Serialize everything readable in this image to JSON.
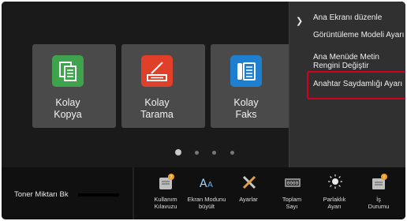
{
  "home": {
    "tiles": [
      {
        "line1": "Kolay",
        "line2": "Kopya",
        "icon": "copy-icon",
        "color": "#3fa34d"
      },
      {
        "line1": "Kolay",
        "line2": "Tarama",
        "icon": "scan-icon",
        "color": "#e0402a"
      },
      {
        "line1": "Kolay",
        "line2": "Faks",
        "icon": "fax-icon",
        "color": "#1e7fd0"
      }
    ],
    "page_count": 4,
    "current_page": 1
  },
  "menu": {
    "items": [
      {
        "line1": "Ana Ekranı düzenle",
        "line2": ""
      },
      {
        "line1": "Görüntüleme Modeli Ayarı",
        "line2": ""
      },
      {
        "line1": "Ana Menüde Metin",
        "line2": "Rengini Değiştir"
      },
      {
        "line1": "Anahtar Saydamlığı Ayarı",
        "line2": ""
      }
    ],
    "highlighted_index": 3,
    "highlight_color": "#d4001f"
  },
  "taskbar": {
    "toner_label": "Toner Miktarı Bk",
    "items": [
      {
        "line1": "Kullanım",
        "line2": "Kılavuzu",
        "icon": "manual-icon"
      },
      {
        "line1": "Ekran Modunu",
        "line2": "büyült",
        "icon": "zoom-text-icon"
      },
      {
        "line1": "Ayarlar",
        "line2": "",
        "icon": "settings-tools-icon"
      },
      {
        "line1": "Toplam",
        "line2": "Sayı",
        "icon": "counter-icon"
      },
      {
        "line1": "Parlaklık",
        "line2": "Ayarı",
        "icon": "brightness-icon"
      },
      {
        "line1": "İş",
        "line2": "Durumu",
        "icon": "job-status-icon"
      }
    ]
  }
}
